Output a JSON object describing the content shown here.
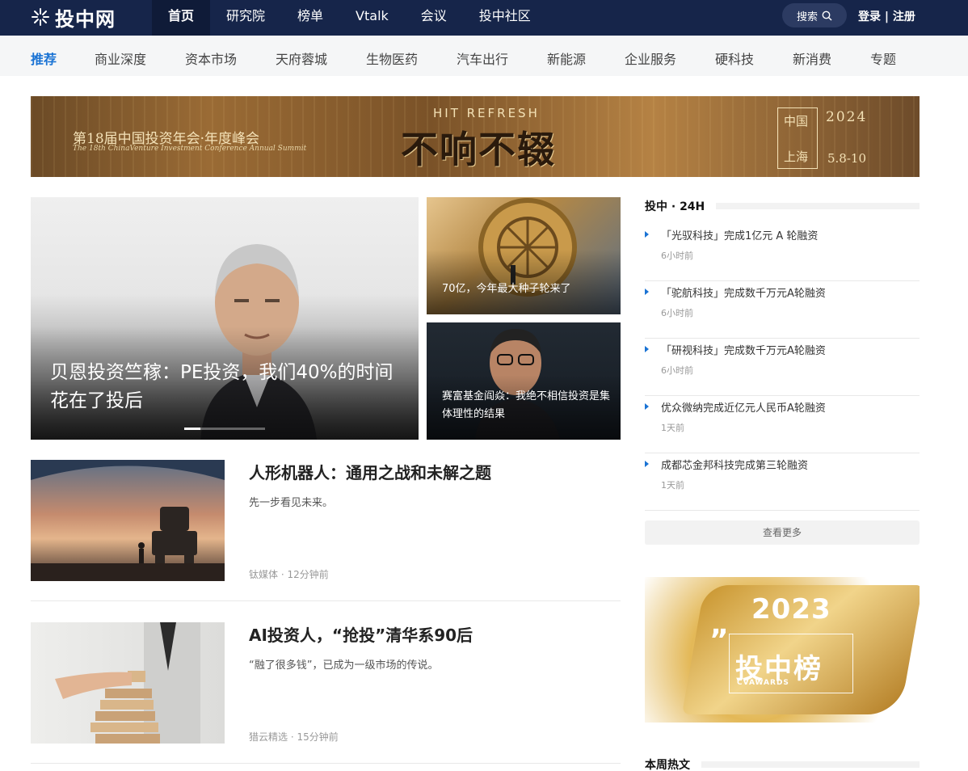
{
  "brand": {
    "logo_text": "投中网"
  },
  "topnav": {
    "items": [
      {
        "label": "首页",
        "active": true
      },
      {
        "label": "研究院"
      },
      {
        "label": "榜单"
      },
      {
        "label": "Vtalk"
      },
      {
        "label": "会议"
      },
      {
        "label": "投中社区"
      }
    ],
    "search_label": "搜索",
    "login_label": "登录 | 注册"
  },
  "subnav": {
    "items": [
      "推荐",
      "商业深度",
      "资本市场",
      "天府蓉城",
      "生物医药",
      "汽车出行",
      "新能源",
      "企业服务",
      "硬科技",
      "新消费",
      "专题"
    ],
    "active_index": 0
  },
  "banner": {
    "conference_title": "第18届中国投资年会·年度峰会",
    "conference_en": "The 18th ChinaVenture Investment Conference Annual Summit",
    "hit_refresh": "HIT REFRESH",
    "slogan": "不响不辍",
    "country": "中国",
    "city": "上海",
    "year": "2024",
    "dates": "5.8-10"
  },
  "hero": {
    "main_title": "贝恩投资竺稼：PE投资，我们40%的时间花在了投后",
    "slides_total": 5,
    "slides_active": 1,
    "side": [
      {
        "title": "70亿，今年最大种子轮来了"
      },
      {
        "title": "赛富基金阎焱：我绝不相信投资是集体理性的结果"
      }
    ]
  },
  "articles": [
    {
      "title": "人形机器人：通用之战和未解之题",
      "desc": "先一步看见未来。",
      "source": "钛媒体",
      "time": "12分钟前"
    },
    {
      "title": "AI投资人，“抢投”清华系90后",
      "desc": "“融了很多钱”，已成为一级市场的传说。",
      "source": "猎云精选",
      "time": "15分钟前"
    }
  ],
  "sidebar": {
    "news_header": "投中 · 24H",
    "news": [
      {
        "title": "「光驭科技」完成1亿元 A 轮融资",
        "time": "6小时前"
      },
      {
        "title": "「驼航科技」完成数千万元A轮融资",
        "time": "6小时前"
      },
      {
        "title": "「研视科技」完成数千万元A轮融资",
        "time": "6小时前"
      },
      {
        "title": "优众微纳完成近亿元人民币A轮融资",
        "time": "1天前"
      },
      {
        "title": "成都芯金邦科技完成第三轮融资",
        "time": "1天前"
      }
    ],
    "more_label": "查看更多",
    "award": {
      "year": "2023",
      "title": "投中榜",
      "sub": "CVAWARDS"
    },
    "weekly_header": "本周热文"
  },
  "colors": {
    "topbar": "#16254a",
    "accent": "#1a73d4"
  }
}
